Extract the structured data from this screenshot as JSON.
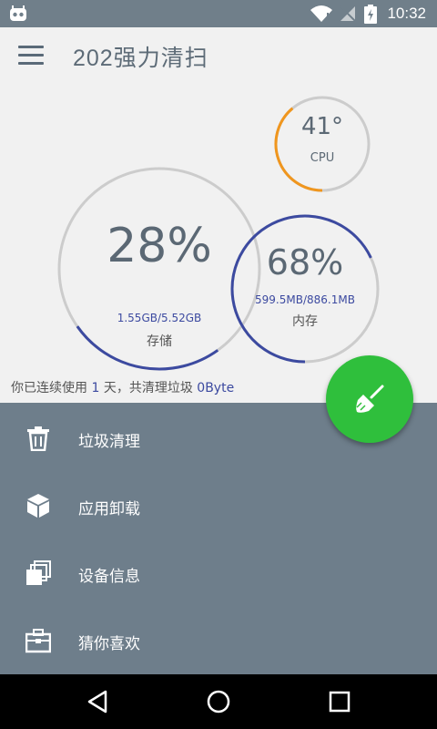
{
  "statusbar": {
    "time": "10:32"
  },
  "toolbar": {
    "title": "202强力清扫"
  },
  "storage": {
    "percent": "28%",
    "detail": "1.55GB/5.52GB",
    "label": "存储",
    "fraction": 0.28
  },
  "cpu": {
    "temp": "41°",
    "label": "CPU",
    "fraction": 0.41
  },
  "memory": {
    "percent": "68%",
    "detail": "599.5MB/886.1MB",
    "label": "内存",
    "fraction": 0.68
  },
  "usage": {
    "prefix": "你已连续使用",
    "days": "1",
    "mid": "天，共清理垃圾",
    "amount": "0Byte"
  },
  "menu": [
    {
      "label": "垃圾清理",
      "icon": "trash-icon"
    },
    {
      "label": "应用卸载",
      "icon": "package-icon"
    },
    {
      "label": "设备信息",
      "icon": "device-info-icon"
    },
    {
      "label": "猜你喜欢",
      "icon": "briefcase-icon"
    }
  ],
  "colors": {
    "accent": "#3c4aa0",
    "cpu_arc": "#f0961e",
    "fab": "#2fbf3c",
    "panel": "#6e7e8b"
  }
}
